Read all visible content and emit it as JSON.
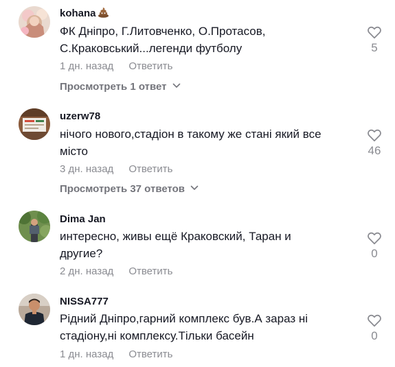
{
  "comments": [
    {
      "username": "kohana",
      "username_badge": "poop-emoji",
      "text_lines": [
        "ФК Дніпро, Г.Литовченко, О.Протасов,",
        "С.Краковський...легенди футболу"
      ],
      "time": "1 дн. назад",
      "reply_label": "Ответить",
      "view_replies": "Просмотреть 1 ответ",
      "likes": "5"
    },
    {
      "username": "uzerw78",
      "text_lines": [
        "нічого нового,стадіон в такому же стані який все",
        "місто"
      ],
      "time": "3 дн. назад",
      "reply_label": "Ответить",
      "view_replies": "Просмотреть 37 ответов",
      "likes": "46"
    },
    {
      "username": "Dima Jan",
      "text_lines": [
        "интересно, живы ещё Краковский, Таран и",
        "другие?"
      ],
      "time": "2 дн. назад",
      "reply_label": "Ответить",
      "likes": "0"
    },
    {
      "username": "NISSA777",
      "text_lines": [
        "Рідний Дніпро,гарний комплекс був.А зараз ні",
        "стадіону,ні комплексу.Тільки басейн"
      ],
      "time": "1 дн. назад",
      "reply_label": "Ответить",
      "likes": "0"
    }
  ],
  "icons": {
    "like": "heart-outline-icon",
    "expand": "chevron-down-icon"
  },
  "colors": {
    "primary_text": "#161823",
    "secondary_text": "#8a8b91",
    "heart_stroke": "#8a8b91"
  }
}
